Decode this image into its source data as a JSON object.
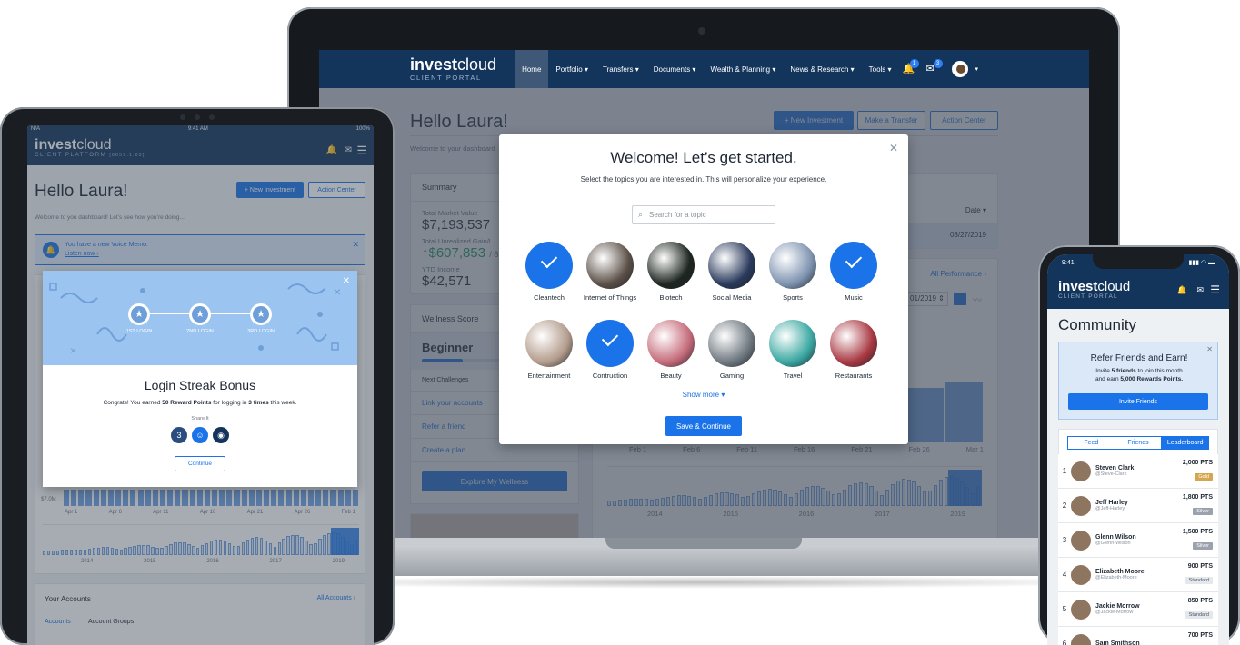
{
  "laptop": {
    "brand": {
      "bold": "invest",
      "light": "cloud",
      "sub": "CLIENT PORTAL"
    },
    "nav": [
      {
        "label": "Home",
        "active": true
      },
      {
        "label": "Portfolio ▾"
      },
      {
        "label": "Transfers ▾"
      },
      {
        "label": "Documents ▾"
      },
      {
        "label": "Wealth & Planning ▾"
      },
      {
        "label": "News & Research ▾"
      },
      {
        "label": "Tools ▾"
      }
    ],
    "notif_count": "1",
    "mail_count": "3",
    "greeting": "Hello Laura!",
    "welcome": "Welcome to your dashboard",
    "buttons": {
      "new_investment": "+ New Investment",
      "transfer": "Make a Transfer",
      "action_center": "Action Center"
    },
    "summary": {
      "title": "Summary",
      "market_value_label": "Total Market Value",
      "market_value": "$7,193,537",
      "unrealized_label": "Total Unrealized Gain/L",
      "unrealized": "↑$607,853",
      "unrealized_pct": "/ 8.",
      "ytd_label": "YTD Income",
      "ytd": "$42,571"
    },
    "table": {
      "date_header": "Date ▾",
      "date_value": "03/27/2019",
      "all_performance": "All Performance ›",
      "date_range": "01/2019 ⇕"
    },
    "wellness": {
      "title": "Wellness Score",
      "level": "Beginner",
      "next": "Next Challenges",
      "items": [
        "Link your accounts",
        "Refer a friend",
        "Create a plan"
      ],
      "explore": "Explore My Wellness"
    },
    "chart_axis": [
      "Feb 1",
      "Feb 6",
      "Feb 11",
      "Feb 16",
      "Feb 21",
      "Feb 26",
      "Mar 1"
    ],
    "year_axis": [
      "2014",
      "2015",
      "2016",
      "2017",
      "2019"
    ],
    "modal": {
      "title": "Welcome! Let’s get started.",
      "subtitle": "Select the topics you are interested in. This will personalize your experience.",
      "search_placeholder": "Search for a topic",
      "topics": [
        {
          "label": "Cleantech",
          "selected": true
        },
        {
          "label": "Internet of Things",
          "selected": false,
          "color": "#5b5048"
        },
        {
          "label": "Biotech",
          "selected": false,
          "color": "#1e2620"
        },
        {
          "label": "Social Media",
          "selected": false,
          "color": "#2a3a5c"
        },
        {
          "label": "Sports",
          "selected": false,
          "color": "#7e93b0"
        },
        {
          "label": "Music",
          "selected": true
        },
        {
          "label": "Entertainment",
          "selected": false,
          "color": "#b39c8c"
        },
        {
          "label": "Contruction",
          "selected": true
        },
        {
          "label": "Beauty",
          "selected": false,
          "color": "#c56b7a"
        },
        {
          "label": "Gaming",
          "selected": false,
          "color": "#6f7880"
        },
        {
          "label": "Travel",
          "selected": false,
          "color": "#3aa7a1"
        },
        {
          "label": "Restaurants",
          "selected": false,
          "color": "#a83842"
        }
      ],
      "show_more": "Show more ▾",
      "save": "Save & Continue"
    }
  },
  "tablet": {
    "status": {
      "carrier": "N/A",
      "time": "9:41 AM",
      "battery": "100%"
    },
    "brand": {
      "bold": "invest",
      "light": "cloud",
      "sub": "CLIENT PLATFORM",
      "version": "[8859.1.02]"
    },
    "greeting": "Hello Laura!",
    "welcome": "Welcome to you dashboard! Let’s see how you’re doing...",
    "buttons": {
      "new_investment": "+ New Investment",
      "action_center": "Action Center"
    },
    "memo": {
      "text": "You have a new Voice Memo.",
      "link": "Listen now ›"
    },
    "streak": {
      "steps": [
        "1ST LOGIN",
        "2ND LOGIN",
        "3RD LOGIN"
      ],
      "title": "Login Streak Bonus",
      "message_pre": "Congrats! You earned ",
      "points": "50 Reward Points",
      "message_mid": " for logging in ",
      "times": "3 times",
      "message_post": " this week.",
      "share": "Share It",
      "continue": "Continue"
    },
    "axis_value": "$7.0M",
    "chart_axis": [
      "Apr 1",
      "Apr 6",
      "Apr 11",
      "Apr 16",
      "Apr 21",
      "Apr 26",
      "Feb 1"
    ],
    "year_axis": [
      "2014",
      "2015",
      "2016",
      "2017",
      "2019"
    ],
    "accounts": {
      "title": "Your Accounts",
      "all": "All Accounts ›",
      "tab1": "Accounts",
      "tab2": "Account Groups"
    }
  },
  "phone": {
    "time": "9:41",
    "brand": {
      "bold": "invest",
      "light": "cloud",
      "sub": "CLIENT PORTAL"
    },
    "title": "Community",
    "refer": {
      "title": "Refer Friends and Earn!",
      "line1_pre": "Invite ",
      "line1_bold": "5 friends",
      "line1_post": " to join this month",
      "line2_pre": "and earn ",
      "line2_bold": "5,000 Rewards Points.",
      "button": "Invite Friends"
    },
    "tabs": [
      "Feed",
      "Friends",
      "Leaderboard"
    ],
    "leaderboard": [
      {
        "rank": "1",
        "name": "Steven Clark",
        "handle": "@Steve-Clark",
        "pts": "2,000 PTS",
        "tier": "Gold",
        "tier_color": "#d4a650"
      },
      {
        "rank": "2",
        "name": "Jeff Harley",
        "handle": "@Jeff-Harley",
        "pts": "1,800 PTS",
        "tier": "Silver",
        "tier_color": "#9aa3ad"
      },
      {
        "rank": "3",
        "name": "Glenn Wilson",
        "handle": "@Glenn-Wilson",
        "pts": "1,500 PTS",
        "tier": "Silver",
        "tier_color": "#9aa3ad"
      },
      {
        "rank": "4",
        "name": "Elizabeth Moore",
        "handle": "@Elizabeth-Moore",
        "pts": "900 PTS",
        "tier": "Standard",
        "tier_color": "#e4e7eb"
      },
      {
        "rank": "5",
        "name": "Jackie Morrow",
        "handle": "@Jackie-Morrow",
        "pts": "850 PTS",
        "tier": "Standard",
        "tier_color": "#e4e7eb"
      },
      {
        "rank": "6",
        "name": "Sam Smithson",
        "handle": "",
        "pts": "700 PTS",
        "tier": "",
        "tier_color": "#e4e7eb"
      }
    ]
  }
}
